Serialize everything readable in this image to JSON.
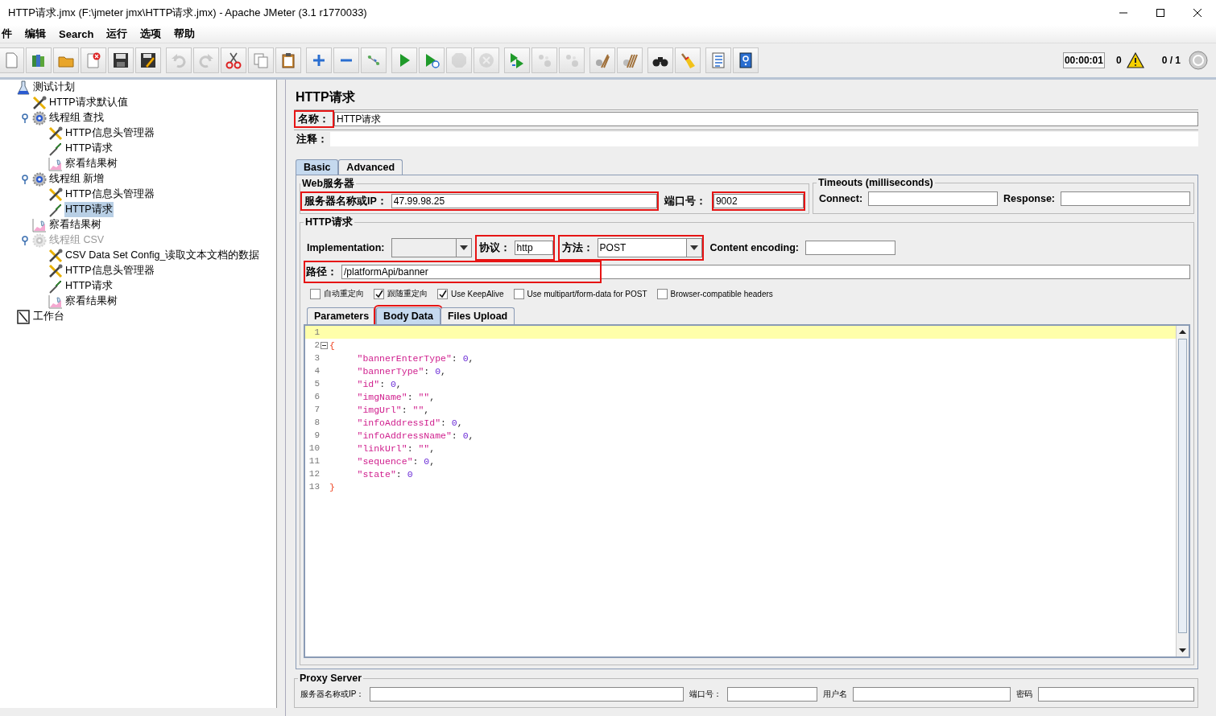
{
  "window": {
    "title": "HTTP请求.jmx (F:\\jmeter jmx\\HTTP请求.jmx) - Apache JMeter (3.1 r1770033)"
  },
  "menu": [
    "件",
    "编辑",
    "Search",
    "运行",
    "选项",
    "帮助"
  ],
  "toolbar": [
    [
      {
        "kind": "new",
        "disabled": false
      },
      {
        "kind": "templates",
        "disabled": false
      },
      {
        "kind": "open",
        "disabled": false
      },
      {
        "kind": "close",
        "disabled": false
      },
      {
        "kind": "save",
        "disabled": false
      },
      {
        "kind": "save-as",
        "disabled": false
      }
    ],
    [
      {
        "kind": "undo",
        "disabled": true
      },
      {
        "kind": "redo",
        "disabled": true
      },
      {
        "kind": "cut",
        "disabled": false
      },
      {
        "kind": "copy",
        "disabled": false
      },
      {
        "kind": "paste",
        "disabled": false
      }
    ],
    [
      {
        "kind": "expand",
        "disabled": false
      },
      {
        "kind": "collapse",
        "disabled": false
      },
      {
        "kind": "toggle",
        "disabled": false
      }
    ],
    [
      {
        "kind": "start",
        "disabled": false
      },
      {
        "kind": "start-no-pause",
        "disabled": false
      },
      {
        "kind": "stop",
        "disabled": true
      },
      {
        "kind": "shutdown",
        "disabled": true
      }
    ],
    [
      {
        "kind": "remote-start",
        "disabled": false
      },
      {
        "kind": "remote-stop",
        "disabled": true
      },
      {
        "kind": "remote-exit",
        "disabled": true
      }
    ],
    [
      {
        "kind": "clear",
        "disabled": false
      },
      {
        "kind": "clear-all",
        "disabled": false
      }
    ],
    [
      {
        "kind": "search",
        "disabled": false
      },
      {
        "kind": "reset-search",
        "disabled": false
      }
    ],
    [
      {
        "kind": "function-helper",
        "disabled": false
      },
      {
        "kind": "help",
        "disabled": false
      }
    ]
  ],
  "status": {
    "timer": "00:00:01",
    "warnings": "0",
    "threads": "0 / 1"
  },
  "tree": [
    {
      "label": "测试计划",
      "kind": "plan",
      "selected": false,
      "disabled": false,
      "children": [
        {
          "label": "HTTP请求默认值",
          "kind": "config",
          "selected": false,
          "disabled": false
        },
        {
          "label": "线程组 查找",
          "kind": "threadgroup",
          "selected": false,
          "disabled": false,
          "expanded": true,
          "children": [
            {
              "label": "HTTP信息头管理器",
              "kind": "config",
              "selected": false,
              "disabled": false
            },
            {
              "label": "HTTP请求",
              "kind": "sampler",
              "selected": false,
              "disabled": false
            },
            {
              "label": "察看结果树",
              "kind": "listener",
              "selected": false,
              "disabled": false
            }
          ]
        },
        {
          "label": "线程组 新增",
          "kind": "threadgroup",
          "selected": false,
          "disabled": false,
          "expanded": true,
          "children": [
            {
              "label": "HTTP信息头管理器",
              "kind": "config",
              "selected": false,
              "disabled": false
            },
            {
              "label": "HTTP请求",
              "kind": "sampler",
              "selected": true,
              "disabled": false
            }
          ]
        },
        {
          "label": "察看结果树",
          "kind": "listener",
          "selected": false,
          "disabled": false
        },
        {
          "label": "线程组  CSV",
          "kind": "threadgroup",
          "selected": false,
          "disabled": true,
          "expanded": true,
          "children": [
            {
              "label": "CSV Data Set Config_读取文本文档的数据",
              "kind": "config",
              "selected": false,
              "disabled": false
            },
            {
              "label": "HTTP信息头管理器",
              "kind": "config",
              "selected": false,
              "disabled": false
            },
            {
              "label": "HTTP请求",
              "kind": "sampler",
              "selected": false,
              "disabled": false
            },
            {
              "label": "察看结果树",
              "kind": "listener",
              "selected": false,
              "disabled": false
            }
          ]
        }
      ]
    },
    {
      "label": "工作台",
      "kind": "workbench",
      "selected": false,
      "disabled": false
    }
  ],
  "form": {
    "heading": "HTTP请求",
    "name": {
      "label": "名称：",
      "value": "HTTP请求",
      "highlighted": true
    },
    "comment": {
      "label": "注释："
    },
    "tabs": [
      {
        "label": "Basic",
        "selected": true
      },
      {
        "label": "Advanced",
        "selected": false
      }
    ],
    "web_server": {
      "legend": "Web服务器",
      "server": {
        "label": "服务器名称或IP：",
        "value": "47.99.98.25",
        "highlighted": true
      },
      "port": {
        "label": "端口号：",
        "value": "9002",
        "highlighted": true
      }
    },
    "timeouts": {
      "legend": "Timeouts (milliseconds)",
      "connect": {
        "label": "Connect:"
      },
      "response": {
        "label": "Response:"
      }
    },
    "http": {
      "legend": "HTTP请求",
      "implementation": {
        "label": "Implementation:"
      },
      "protocol": {
        "label": "协议：",
        "value": "http",
        "highlighted": true
      },
      "method": {
        "label": "方法：",
        "value": "POST",
        "highlighted": true
      },
      "encoding": {
        "label": "Content encoding:"
      },
      "path": {
        "label": "路径：",
        "value": "/platformApi/banner",
        "highlighted": true
      },
      "options": [
        {
          "label": "自动重定向",
          "checked": false
        },
        {
          "label": "跟随重定向",
          "checked": true
        },
        {
          "label": "Use KeepAlive",
          "checked": true
        },
        {
          "label": "Use multipart/form-data for POST",
          "checked": false
        },
        {
          "label": "Browser-compatible headers",
          "checked": false
        }
      ],
      "body_tabs": [
        {
          "label": "Parameters",
          "selected": false,
          "highlighted": false
        },
        {
          "label": "Body Data",
          "selected": true,
          "highlighted": true
        },
        {
          "label": "Files Upload",
          "selected": false,
          "highlighted": false
        }
      ],
      "code": [
        {
          "num": "1",
          "current": true,
          "fold": false
        },
        {
          "num": "2",
          "text": "{",
          "current": false,
          "fold": true
        },
        {
          "num": "3",
          "text": "     \"bannerEnterType\": 0,",
          "current": false,
          "fold": false
        },
        {
          "num": "4",
          "text": "     \"bannerType\": 0,",
          "current": false,
          "fold": false
        },
        {
          "num": "5",
          "text": "     \"id\": 0,",
          "current": false,
          "fold": false
        },
        {
          "num": "6",
          "text": "     \"imgName\": \"\",",
          "current": false,
          "fold": false
        },
        {
          "num": "7",
          "text": "     \"imgUrl\": \"\",",
          "current": false,
          "fold": false
        },
        {
          "num": "8",
          "text": "     \"infoAddressId\": 0,",
          "current": false,
          "fold": false
        },
        {
          "num": "9",
          "text": "     \"infoAddressName\": 0,",
          "current": false,
          "fold": false
        },
        {
          "num": "10",
          "text": "     \"linkUrl\": \"\",",
          "current": false,
          "fold": false
        },
        {
          "num": "11",
          "text": "     \"sequence\": 0,",
          "current": false,
          "fold": false
        },
        {
          "num": "12",
          "text": "     \"state\": 0",
          "current": false,
          "fold": false
        },
        {
          "num": "13",
          "text": "}",
          "current": false,
          "fold": false
        }
      ]
    },
    "proxy": {
      "legend": "Proxy Server",
      "fields": [
        {
          "label": "服务器名称或IP："
        },
        {
          "label": "端口号："
        },
        {
          "label": "用户名"
        },
        {
          "label": "密码"
        }
      ]
    }
  }
}
